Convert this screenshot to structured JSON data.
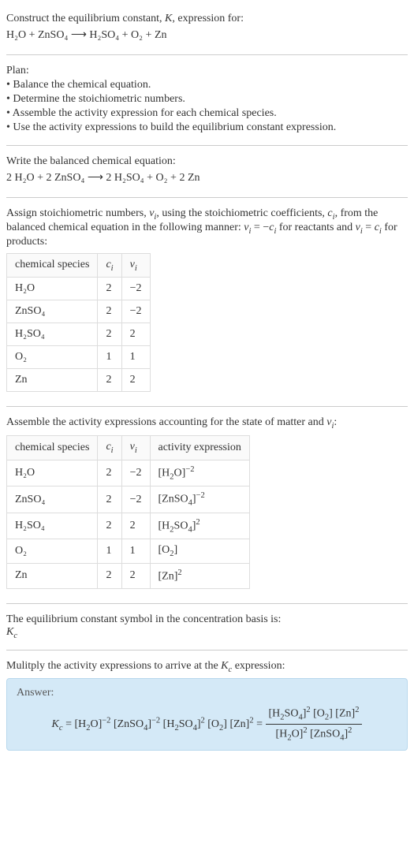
{
  "header": {
    "construct_line": "Construct the equilibrium constant, K, expression for:",
    "equation": "H₂O + ZnSO₄ ⟶ H₂SO₄ + O₂ + Zn"
  },
  "plan": {
    "label": "Plan:",
    "items": [
      "• Balance the chemical equation.",
      "• Determine the stoichiometric numbers.",
      "• Assemble the activity expression for each chemical species.",
      "• Use the activity expressions to build the equilibrium constant expression."
    ]
  },
  "balanced": {
    "intro": "Write the balanced chemical equation:",
    "equation": "2 H₂O + 2 ZnSO₄ ⟶ 2 H₂SO₄ + O₂ + 2 Zn"
  },
  "assign": {
    "text_part1": "Assign stoichiometric numbers, νᵢ, using the stoichiometric coefficients, cᵢ, from the balanced chemical equation in the following manner: νᵢ = −cᵢ for reactants and νᵢ = cᵢ for products:",
    "headers": {
      "species": "chemical species",
      "ci": "cᵢ",
      "vi": "νᵢ"
    },
    "rows": [
      {
        "species": "H₂O",
        "ci": "2",
        "vi": "−2"
      },
      {
        "species": "ZnSO₄",
        "ci": "2",
        "vi": "−2"
      },
      {
        "species": "H₂SO₄",
        "ci": "2",
        "vi": "2"
      },
      {
        "species": "O₂",
        "ci": "1",
        "vi": "1"
      },
      {
        "species": "Zn",
        "ci": "2",
        "vi": "2"
      }
    ]
  },
  "activity": {
    "intro": "Assemble the activity expressions accounting for the state of matter and νᵢ:",
    "headers": {
      "species": "chemical species",
      "ci": "cᵢ",
      "vi": "νᵢ",
      "expr": "activity expression"
    },
    "rows": [
      {
        "species": "H₂O",
        "ci": "2",
        "vi": "−2",
        "expr": "[H₂O]⁻²"
      },
      {
        "species": "ZnSO₄",
        "ci": "2",
        "vi": "−2",
        "expr": "[ZnSO₄]⁻²"
      },
      {
        "species": "H₂SO₄",
        "ci": "2",
        "vi": "2",
        "expr": "[H₂SO₄]²"
      },
      {
        "species": "O₂",
        "ci": "1",
        "vi": "1",
        "expr": "[O₂]"
      },
      {
        "species": "Zn",
        "ci": "2",
        "vi": "2",
        "expr": "[Zn]²"
      }
    ]
  },
  "symbol": {
    "intro": "The equilibrium constant symbol in the concentration basis is:",
    "value": "K_c"
  },
  "multiply": {
    "intro": "Mulitply the activity expressions to arrive at the K_c expression:"
  },
  "answer": {
    "label": "Answer:",
    "lhs": "K_c = [H₂O]⁻² [ZnSO₄]⁻² [H₂SO₄]² [O₂] [Zn]² =",
    "frac_num": "[H₂SO₄]² [O₂] [Zn]²",
    "frac_den": "[H₂O]² [ZnSO₄]²"
  }
}
